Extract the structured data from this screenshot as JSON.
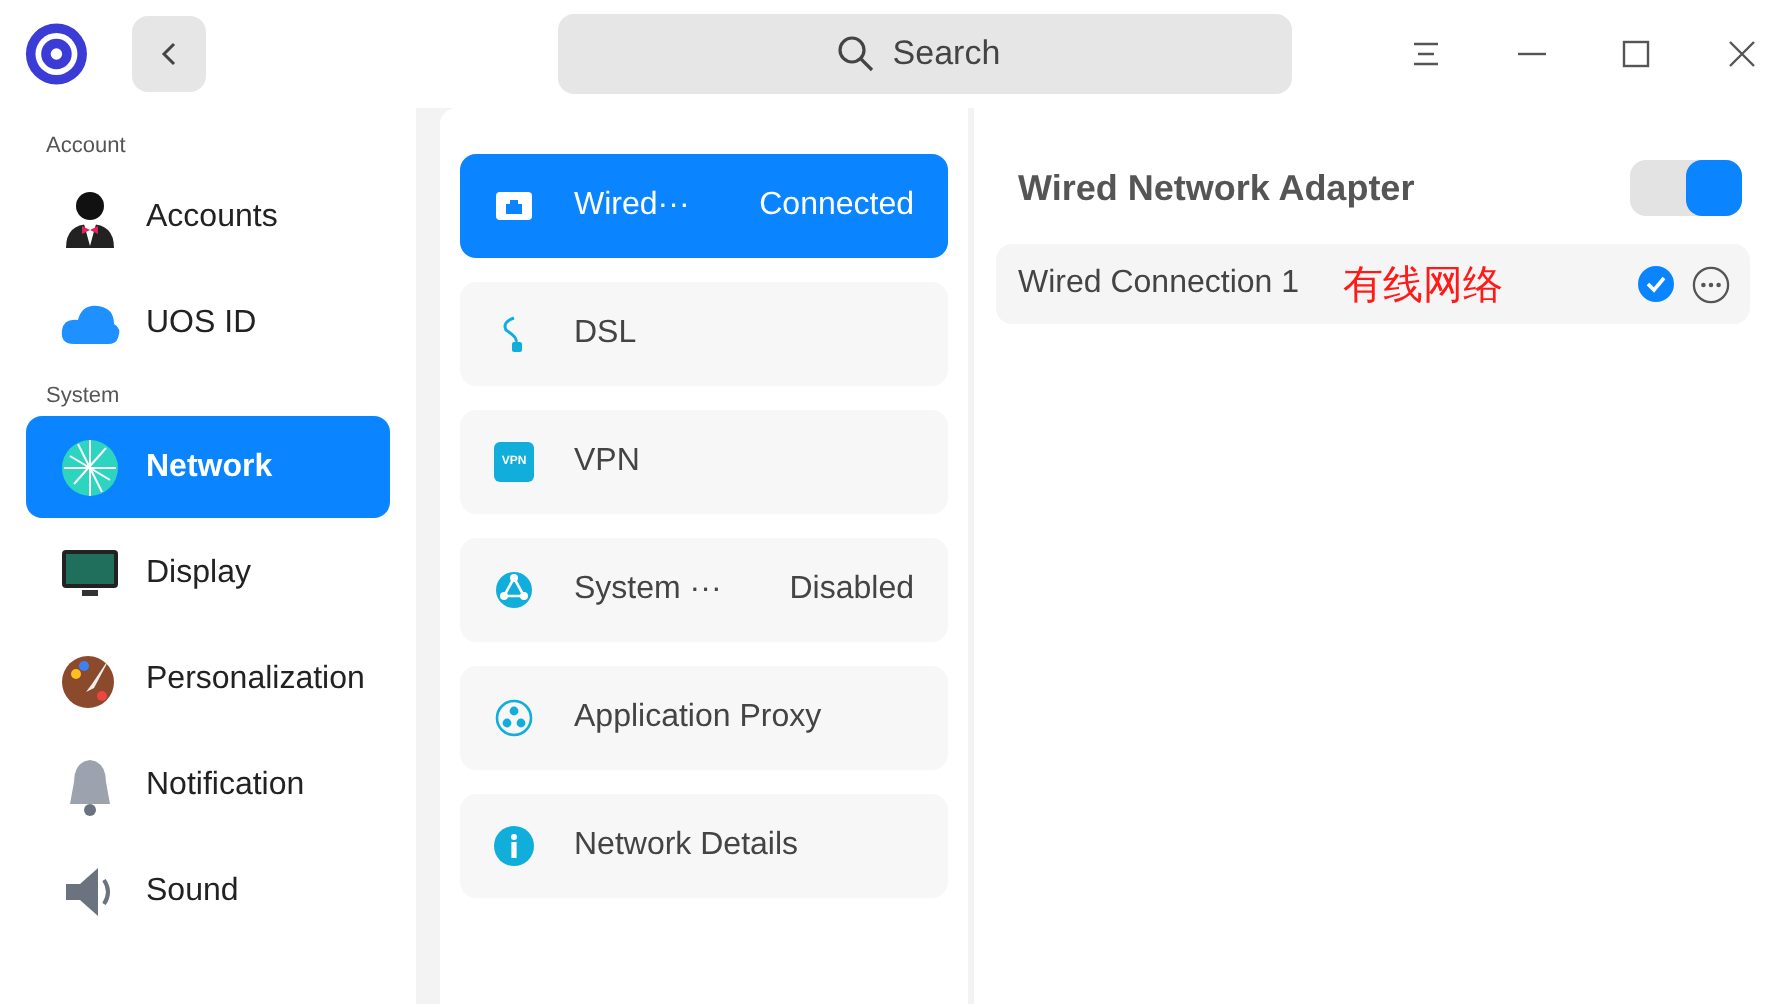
{
  "titlebar": {
    "search_placeholder": "Search"
  },
  "sidebar": {
    "groups": [
      {
        "title": "Account",
        "items": [
          {
            "label": "Accounts",
            "selected": false
          },
          {
            "label": "UOS ID",
            "selected": false
          }
        ]
      },
      {
        "title": "System",
        "items": [
          {
            "label": "Network",
            "selected": true
          },
          {
            "label": "Display",
            "selected": false
          },
          {
            "label": "Personalization",
            "selected": false
          },
          {
            "label": "Notification",
            "selected": false
          },
          {
            "label": "Sound",
            "selected": false
          }
        ]
      }
    ]
  },
  "network_types": [
    {
      "label": "Wired···",
      "status": "Connected",
      "selected": true
    },
    {
      "label": "DSL",
      "selected": false
    },
    {
      "label": "VPN",
      "icon_label": "VPN",
      "selected": false
    },
    {
      "label": "System ···",
      "status": "Disabled",
      "selected": false
    },
    {
      "label": "Application Proxy",
      "selected": false
    },
    {
      "label": "Network Details",
      "selected": false
    }
  ],
  "detail": {
    "title": "Wired Network Adapter",
    "on": true,
    "connections": [
      {
        "name": "Wired Connection 1",
        "annotation": "有线网络",
        "connected": true
      }
    ]
  }
}
